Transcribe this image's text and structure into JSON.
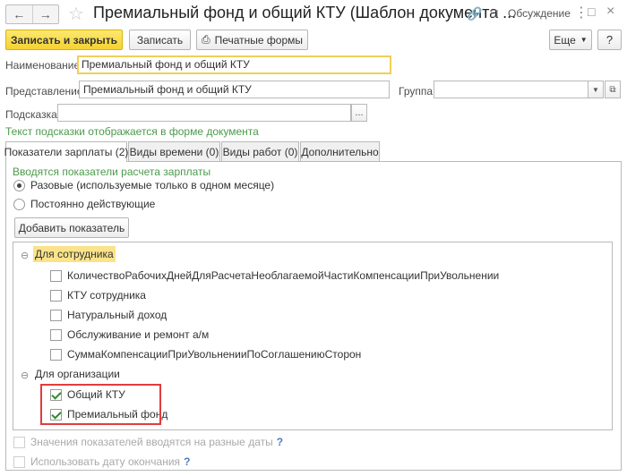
{
  "titlebar": {
    "title": "Премиальный фонд и общий КТУ (Шаблон документа ...",
    "discussion_label": "Обсуждение"
  },
  "toolbar": {
    "save_close_label": "Записать и закрыть",
    "save_label": "Записать",
    "print_label": "Печатные формы",
    "more_label": "Еще"
  },
  "form": {
    "name_label": "Наименование:",
    "name_value": "Премиальный фонд и общий КТУ",
    "repr_label": "Представление:",
    "repr_value": "Премиальный фонд и общий КТУ",
    "group_label": "Группа:",
    "group_value": "",
    "hint_label": "Подсказка:",
    "hint_value": "",
    "hint_note": "Текст подсказки отображается в форме документа",
    "select_button": "..."
  },
  "tabs": [
    {
      "label": "Показатели зарплаты (2)",
      "active": true
    },
    {
      "label": "Виды времени (0)",
      "active": false
    },
    {
      "label": "Виды работ (0)",
      "active": false
    },
    {
      "label": "Дополнительно",
      "active": false
    }
  ],
  "indicators": {
    "heading": "Вводятся показатели расчета зарплаты",
    "option_once": "Разовые (используемые только в одном месяце)",
    "option_permanent": "Постоянно действующие",
    "selected": "once",
    "add_button": "Добавить показатель"
  },
  "tree": {
    "employee_group": "Для сотрудника",
    "employee_items": [
      {
        "label": "КоличествоРабочихДнейДляРасчетаНеоблагаемойЧастиКомпенсацииПриУвольнении",
        "checked": false
      },
      {
        "label": "КТУ сотрудника",
        "checked": false
      },
      {
        "label": "Натуральный доход",
        "checked": false
      },
      {
        "label": "Обслуживание и ремонт а/м",
        "checked": false
      },
      {
        "label": "СуммаКомпенсацииПриУвольненииПоСоглашениюСторон",
        "checked": false
      }
    ],
    "org_group": "Для организации",
    "org_items": [
      {
        "label": "Общий КТУ",
        "checked": true
      },
      {
        "label": "Премиальный фонд",
        "checked": true
      }
    ]
  },
  "footer": {
    "different_dates": "Значения показателей вводятся на разные даты",
    "end_date": "Использовать дату окончания",
    "help": "?"
  },
  "colors": {
    "accent_yellow": "#f5d230",
    "hint_green": "#4b9b4b",
    "highlight_red": "#e23c3c"
  }
}
